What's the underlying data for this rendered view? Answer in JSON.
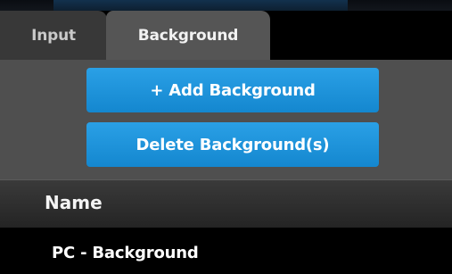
{
  "tabs": [
    {
      "label": "Input",
      "active": false
    },
    {
      "label": "Background",
      "active": true
    }
  ],
  "actions": {
    "add_label": "+ Add Background",
    "delete_label": "Delete Background(s)"
  },
  "table": {
    "columns": [
      "Name"
    ],
    "rows": [
      {
        "name": "PC - Background"
      }
    ]
  },
  "colors": {
    "button": "#1b94dc",
    "panel": "#4f4f4f",
    "active_tab": "#555555"
  }
}
